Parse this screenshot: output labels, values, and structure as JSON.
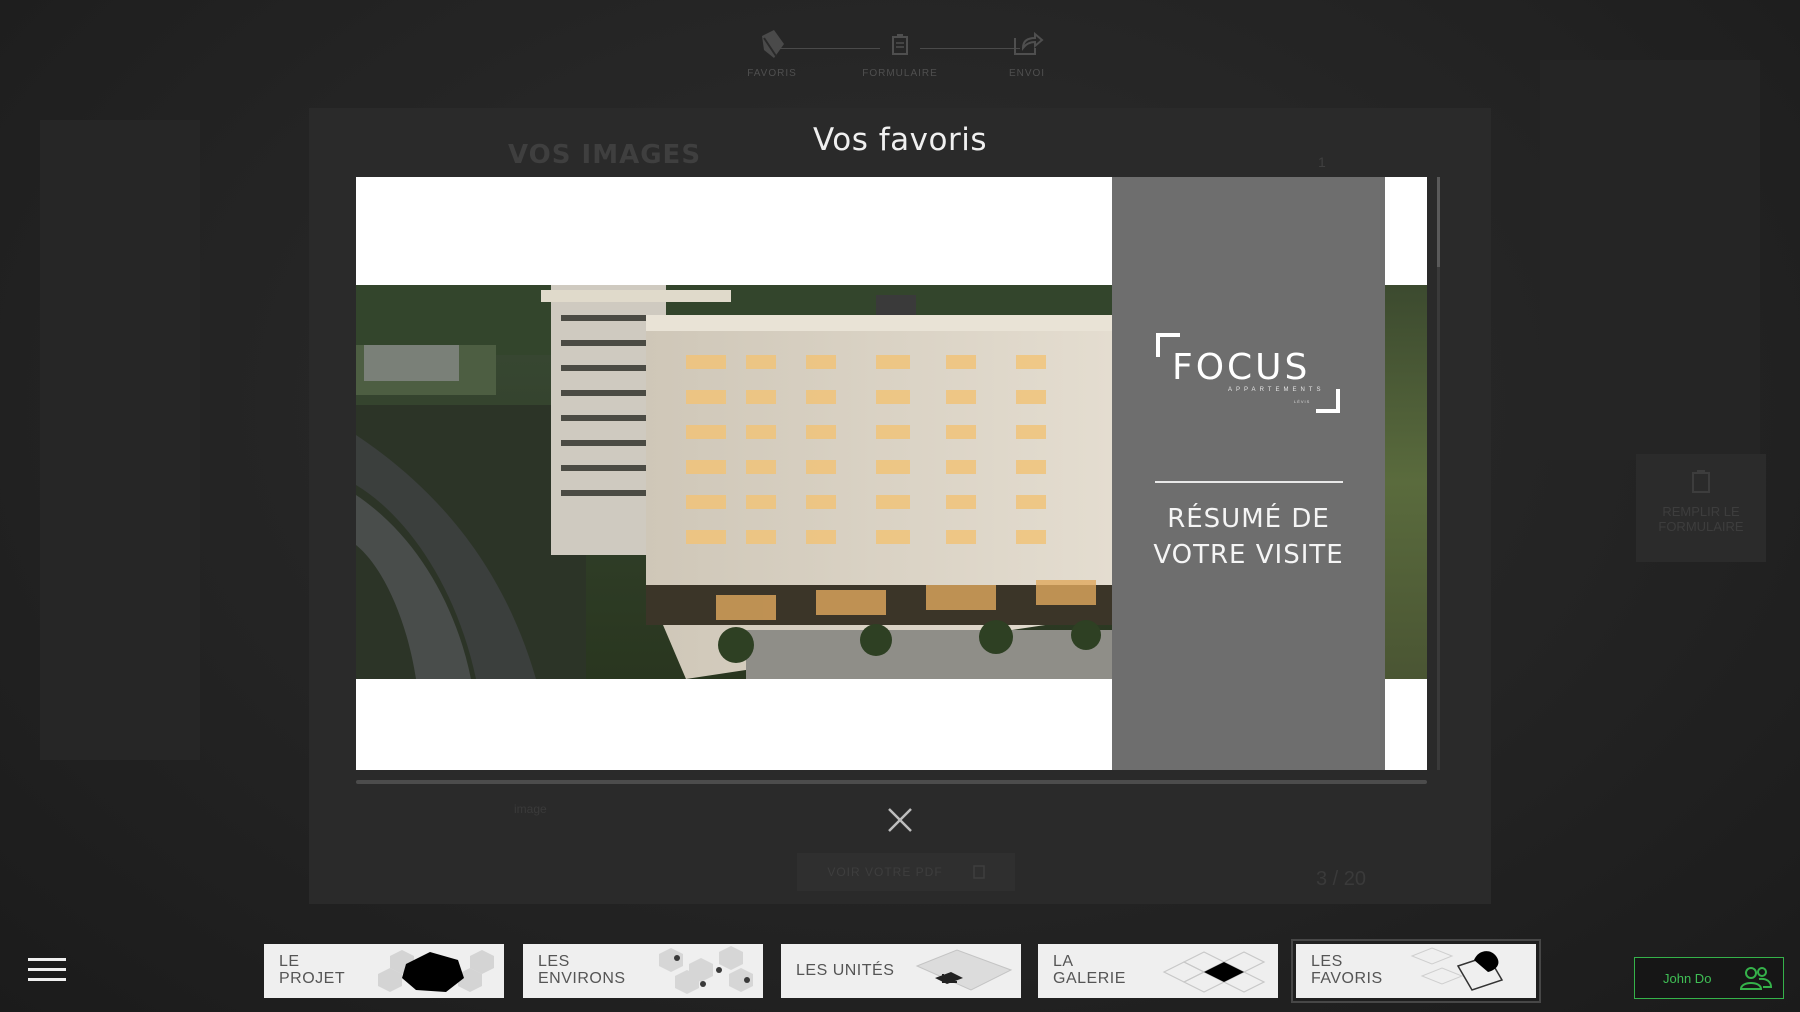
{
  "stepper": {
    "steps": [
      {
        "label": "FAVORIS",
        "icon": "favorites-icon"
      },
      {
        "label": "FORMULAIRE",
        "icon": "clipboard-icon"
      },
      {
        "label": "ENVOI",
        "icon": "share-icon"
      }
    ]
  },
  "background_panel": {
    "title": "VOS IMAGES",
    "count": "1",
    "item_label": "image",
    "pdf_button": "VOIR VOTRE PDF",
    "pagination": "3 / 20"
  },
  "side_action": {
    "label_line1": "REMPLIR LE",
    "label_line2": "FORMULAIRE"
  },
  "modal": {
    "title": "Vos favoris",
    "slide": {
      "logo_word": "FOCUS",
      "logo_sub": "APPARTEMENTS",
      "logo_tiny": "LÉVIS",
      "heading_line1": "RÉSUMÉ DE",
      "heading_line2": "VOTRE VISITE"
    }
  },
  "bottom_nav": [
    {
      "line1": "LE",
      "line2": "PROJET",
      "icon": "project-map-icon"
    },
    {
      "line1": "LES",
      "line2": "ENVIRONS",
      "icon": "surroundings-map-icon"
    },
    {
      "line1": "LES UNITÉS",
      "line2": "",
      "icon": "units-floor-icon"
    },
    {
      "line1": "LA",
      "line2": "GALERIE",
      "icon": "gallery-tile-icon"
    },
    {
      "line1": "LES",
      "line2": "FAVORIS",
      "icon": "favorites-book-icon",
      "active": true
    }
  ],
  "user": {
    "name": "John Do",
    "accent": "#35b24a"
  }
}
